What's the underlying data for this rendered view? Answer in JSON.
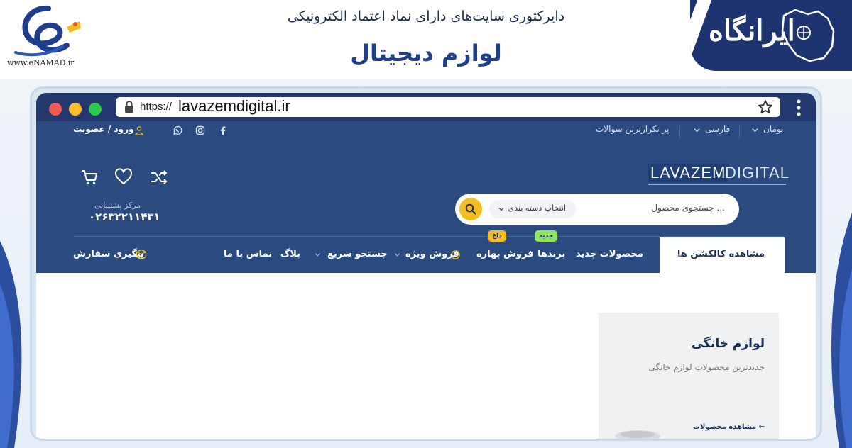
{
  "banner": {
    "enamad_url": "www.eNAMAD.ir",
    "directory_title": "دایرکتوری سایت‌های دارای نماد اعتماد الکترونیکی",
    "site_name": "لوازم دیجیتال",
    "irangah_text": "ایرانگاه"
  },
  "browser": {
    "url_prefix": "https://",
    "url_domain": "lavazemdigital.ir"
  },
  "site": {
    "topbar": {
      "currency": "تومان",
      "language": "فارسی",
      "faq": "پر تکرارترین سوالات",
      "login": "ورود / عضویت"
    },
    "logo": {
      "part1": "LAVAZEM",
      "part2": "DIGITAL"
    },
    "search": {
      "placeholder": "جستجوی محصول ...",
      "category_label": "انتخاب دسته بندی"
    },
    "support": {
      "label": "مرکز پشتیبانی",
      "phone": "۰۲۶۳۲۲۱۱۴۳۱"
    },
    "nav": {
      "collections": "مشاهده کالکشن ها",
      "new_products": "محصولات جدید",
      "brands": "برندها",
      "spring_sale": "فروش بهاره",
      "special_sale": "فروش ویژه",
      "quick_search": "جستجو سریع",
      "blog": "بلاگ",
      "contact": "تماس با ما",
      "order_tracking": "پیگیری سفارش",
      "badge_new": "جدید",
      "badge_hot": "داغ"
    },
    "card": {
      "title": "لوازم خانگی",
      "subtitle": "جدیدترین محصولات لوازم خانگی",
      "link": "مشاهده محصولات ←"
    }
  },
  "colors": {
    "site_header": "#2a4a80",
    "browser_bar": "#22386f",
    "accent_yellow": "#f6bd1d",
    "badge_green": "#8fe65a",
    "title_blue": "#1f3f8a"
  }
}
